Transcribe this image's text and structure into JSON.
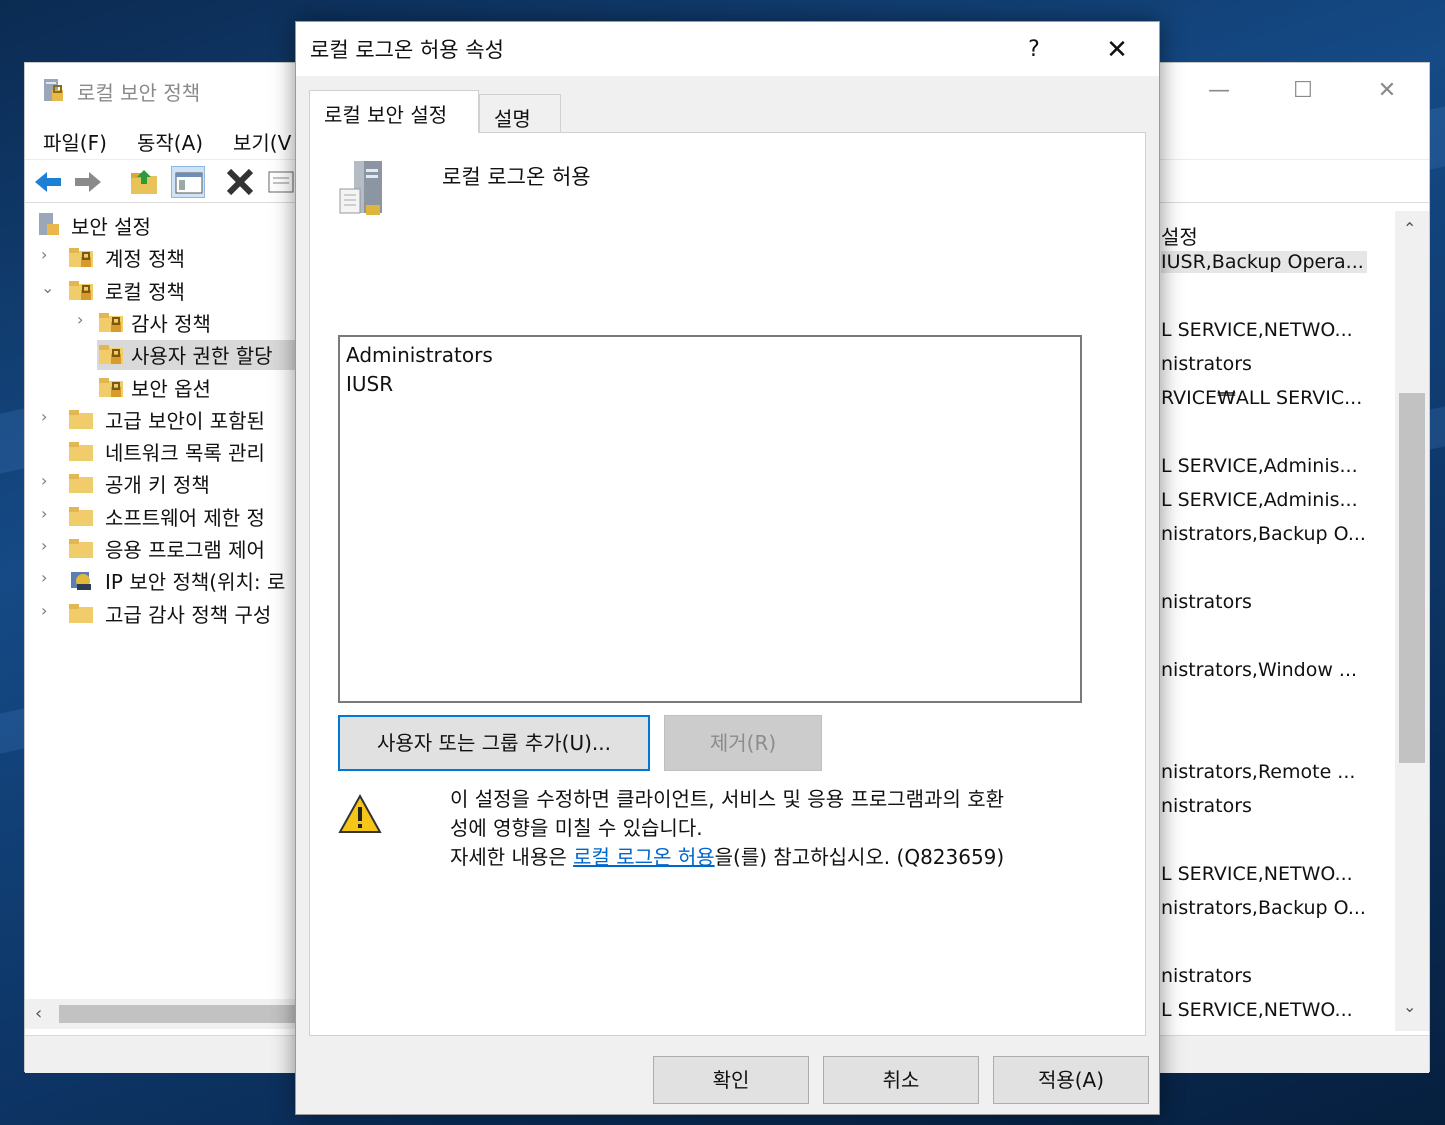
{
  "mmc": {
    "title": "로컬 보안 정책",
    "controls": {
      "minimize": "—",
      "maximize": "☐",
      "close": "✕"
    },
    "menu": [
      "파일(F)",
      "동작(A)",
      "보기(V"
    ],
    "tree": [
      {
        "label": "보안 설정",
        "chev": ""
      },
      {
        "label": "계정 정책",
        "chev": "›"
      },
      {
        "label": "로컬 정책",
        "chev": "⌄"
      },
      {
        "label": "감사 정책",
        "chev": "›"
      },
      {
        "label": "사용자 권한 할당",
        "chev": ""
      },
      {
        "label": "보안 옵션",
        "chev": ""
      },
      {
        "label": "고급 보안이 포함된",
        "chev": "›"
      },
      {
        "label": "네트워크 목록 관리",
        "chev": ""
      },
      {
        "label": "공개 키 정책",
        "chev": "›"
      },
      {
        "label": "소프트웨어 제한 정",
        "chev": "›"
      },
      {
        "label": "응용 프로그램 제어",
        "chev": "›"
      },
      {
        "label": "IP 보안 정책(위치: 로",
        "chev": "›"
      },
      {
        "label": "고급 감사 정책 구성",
        "chev": "›"
      }
    ],
    "right_header": "설정",
    "right_rows": [
      "IUSR,Backup Opera...",
      "L SERVICE,NETWO...",
      "nistrators",
      "RVICE₩ALL SERVIC...",
      "L SERVICE,Adminis...",
      "L SERVICE,Adminis...",
      "nistrators,Backup O...",
      "nistrators",
      "nistrators,Window ...",
      "nistrators,Remote ...",
      "nistrators",
      "L SERVICE,NETWO...",
      "nistrators,Backup O...",
      "nistrators",
      "L SERVICE,NETWO..."
    ],
    "scroll": {
      "left": "‹",
      "up": "⌃",
      "down": "⌄"
    }
  },
  "dialog": {
    "title": "로컬 로그온 허용 속성",
    "help": "?",
    "close": "✕",
    "tabs": [
      "로컬 보안 설정",
      "설명"
    ],
    "policy_name": "로컬 로그온 허용",
    "members": [
      "Administrators",
      "IUSR"
    ],
    "add_button": "사용자 또는 그룹 추가(U)...",
    "remove_button": "제거(R)",
    "warning": {
      "line1": "이 설정을 수정하면 클라이언트, 서비스 및 응용 프로그램과의 호환",
      "line2": "성에 영향을 미칠 수 있습니다.",
      "line3_prefix": "자세한 내용은 ",
      "line3_link": "로컬 로그온 허용",
      "line3_suffix": "을(를) 참고하십시오. (Q823659)"
    },
    "ok": "확인",
    "cancel": "취소",
    "apply": "적용(A)"
  }
}
